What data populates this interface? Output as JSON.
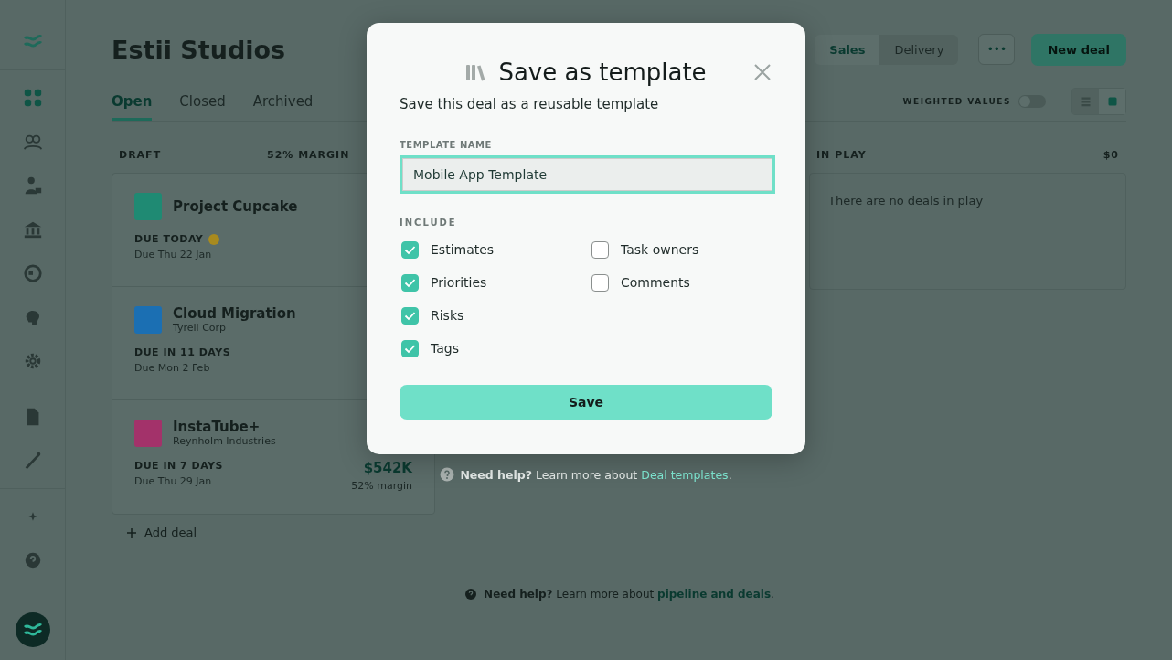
{
  "sidebar": {
    "items": [
      {
        "kind": "grid",
        "selected": true
      },
      {
        "kind": "group",
        "selected": false
      },
      {
        "kind": "person",
        "selected": false
      },
      {
        "kind": "bank",
        "selected": false
      },
      {
        "kind": "globe",
        "selected": false
      },
      {
        "kind": "brain",
        "selected": false
      },
      {
        "kind": "gear",
        "selected": false
      },
      {
        "kind": "doc",
        "selected": false
      },
      {
        "kind": "wand",
        "selected": false
      },
      {
        "kind": "sparkle",
        "selected": false
      },
      {
        "kind": "help",
        "selected": false
      }
    ]
  },
  "header": {
    "title": "Estii Studios",
    "views": [
      {
        "label": "Sales",
        "selected": true
      },
      {
        "label": "Delivery",
        "selected": false
      }
    ],
    "more_button": "•••",
    "new_button": "New deal"
  },
  "tabs": [
    {
      "label": "Open",
      "selected": true
    },
    {
      "label": "Closed",
      "selected": false
    },
    {
      "label": "Archived",
      "selected": false
    }
  ],
  "weighted_values": {
    "label": "WEIGHTED VALUES",
    "on": false
  },
  "view_modes": [
    {
      "kind": "list",
      "selected": false
    },
    {
      "kind": "board",
      "selected": true
    }
  ],
  "columns": [
    {
      "title": "DRAFT",
      "summary": "52% MARGIN",
      "add_label": "Add deal",
      "deals": [
        {
          "name": "Project Cupcake",
          "color": "#1f8a73",
          "alert": true,
          "due_label": "DUE TODAY",
          "due_date": "Due Thu 22 Jan"
        },
        {
          "name": "Cloud Migration",
          "client": "Tyrell Corp",
          "color": "#1b6fb3",
          "alert": false,
          "due_label": "DUE IN 11 DAYS",
          "due_date": "Due Mon 2 Feb"
        },
        {
          "name": "InstaTube+",
          "client": "Reynholm Industries",
          "color": "#a3326a",
          "alert": false,
          "due_label": "DUE IN 7 DAYS",
          "due_date": "Due Thu 29 Jan",
          "value": "$542K",
          "margin": "52% margin"
        }
      ]
    },
    {
      "title": "IN PLAY",
      "summary": "$0",
      "empty_text": "There are no deals in play"
    }
  ],
  "footer_help": {
    "lead": "**Need help?** Learn more about",
    "link": "pipeline and deals",
    "end": "."
  },
  "dialog": {
    "title": "Save as template",
    "subtitle": "Save this deal as a reusable template",
    "name_label": "TEMPLATE NAME",
    "name_value": "Mobile App Template",
    "include_label": "INCLUDE",
    "options": [
      {
        "label": "Estimates",
        "checked": true
      },
      {
        "label": "Priorities",
        "checked": true
      },
      {
        "label": "Risks",
        "checked": true
      },
      {
        "label": "Tags",
        "checked": true
      },
      {
        "label": "Task owners",
        "checked": false
      },
      {
        "label": "Comments",
        "checked": false
      }
    ],
    "save_button": "Save",
    "help": {
      "lead": "**Need help?** Learn more about",
      "link": "Deal templates",
      "end": "."
    }
  }
}
